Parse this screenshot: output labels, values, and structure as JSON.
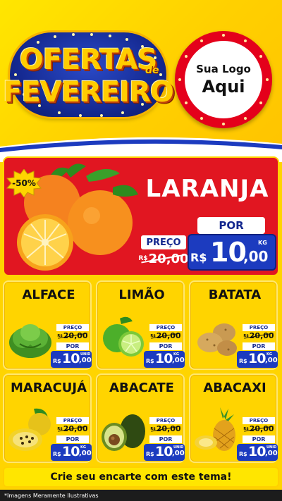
{
  "header": {
    "title_line1": "OFERTAS",
    "title_connector": "de",
    "title_line2": "FEVEREIRO",
    "logo_line1": "Sua Logo",
    "logo_line2": "Aqui"
  },
  "colors": {
    "background_yellow": "#ffd400",
    "hero_red": "#e11621",
    "price_blue": "#1c3bbf",
    "logo_red": "#e4001b"
  },
  "featured": {
    "name": "LARANJA",
    "discount": "-50%",
    "price_label": "PREÇO",
    "old_currency": "R$",
    "old_price": "20,00",
    "por_label": "POR",
    "currency": "R$",
    "price_int": "10",
    "price_dec": ",00",
    "unit": "KG",
    "icon": "orange-fruit-icon"
  },
  "products": [
    {
      "name": "ALFACE",
      "price_label": "PREÇO",
      "old_currency": "R$",
      "old_price": "20,00",
      "por_label": "POR",
      "currency": "R$",
      "price_int": "10",
      "price_dec": ",00",
      "unit": "UNID",
      "icon": "lettuce-icon"
    },
    {
      "name": "LIMÃO",
      "price_label": "PREÇO",
      "old_currency": "R$",
      "old_price": "20,00",
      "por_label": "POR",
      "currency": "R$",
      "price_int": "10",
      "price_dec": ",00",
      "unit": "KG",
      "icon": "lime-icon"
    },
    {
      "name": "BATATA",
      "price_label": "PREÇO",
      "old_currency": "R$",
      "old_price": "20,00",
      "por_label": "POR",
      "currency": "R$",
      "price_int": "10",
      "price_dec": ",00",
      "unit": "KG",
      "icon": "potato-icon"
    },
    {
      "name": "MARACUJÁ",
      "price_label": "PREÇO",
      "old_currency": "R$",
      "old_price": "20,00",
      "por_label": "POR",
      "currency": "R$",
      "price_int": "10",
      "price_dec": ",00",
      "unit": "KG",
      "icon": "passion-fruit-icon"
    },
    {
      "name": "ABACATE",
      "price_label": "PREÇO",
      "old_currency": "R$",
      "old_price": "20,00",
      "por_label": "POR",
      "currency": "R$",
      "price_int": "10",
      "price_dec": ",00",
      "unit": "UNID",
      "icon": "avocado-icon"
    },
    {
      "name": "ABACAXI",
      "price_label": "PREÇO",
      "old_currency": "R$",
      "old_price": "20,00",
      "por_label": "POR",
      "currency": "R$",
      "price_int": "10",
      "price_dec": ",00",
      "unit": "UNID",
      "icon": "pineapple-icon"
    }
  ],
  "cta": "Crie seu encarte com este tema!",
  "footer_note": "*Imagens Meramente Ilustrativas"
}
